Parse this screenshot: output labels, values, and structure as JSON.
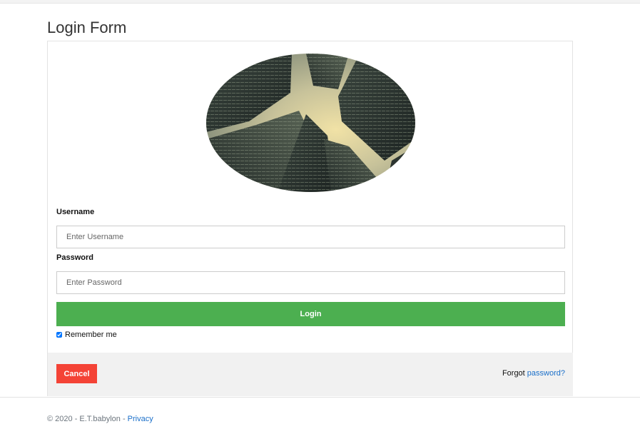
{
  "page": {
    "title": "Login Form"
  },
  "form": {
    "username_label": "Username",
    "username_placeholder": "Enter Username",
    "username_value": "",
    "password_label": "Password",
    "password_placeholder": "Enter Password",
    "password_value": "",
    "login_label": "Login",
    "remember_label": "Remember me",
    "remember_checked": true,
    "cancel_label": "Cancel",
    "forgot_prefix": "Forgot",
    "forgot_link": "password?"
  },
  "footer": {
    "copyright": "© 2020 - E.T.babylon - ",
    "privacy_link": "Privacy"
  },
  "colors": {
    "login_button": "#4caf50",
    "cancel_button": "#f44336",
    "link": "#1a6fc9",
    "footer_band": "#f1f1f1"
  },
  "icons": {
    "avatar": "skyscrapers-photo"
  }
}
